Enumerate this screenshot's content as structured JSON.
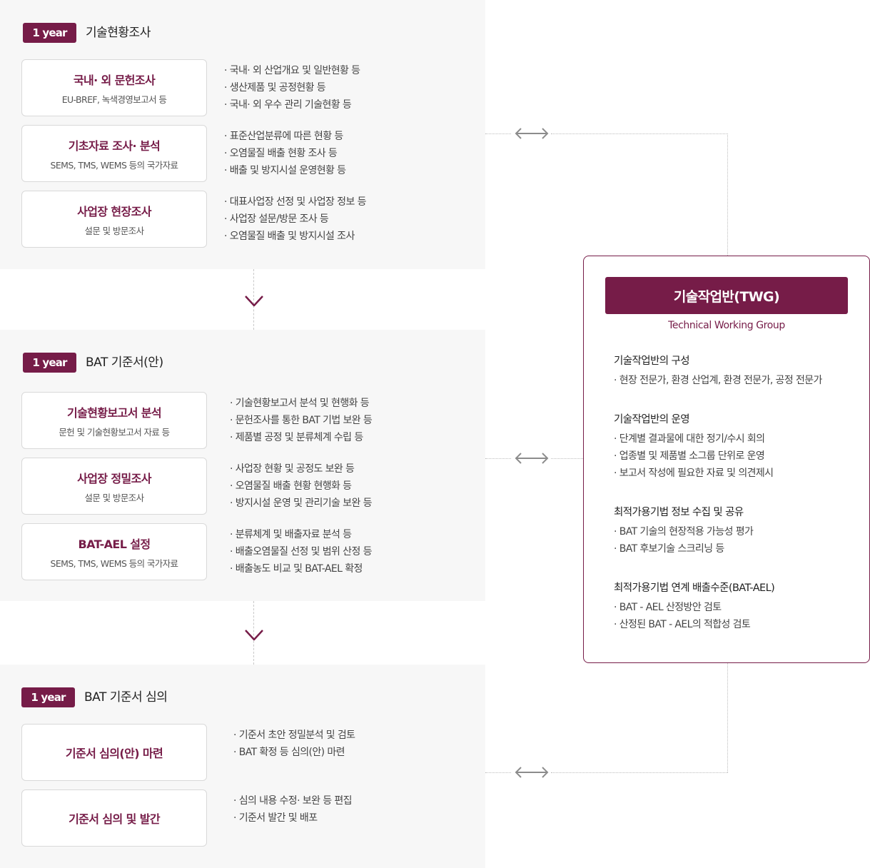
{
  "sections": [
    {
      "badge": "1 year",
      "title": "기술현황조사",
      "steps": [
        {
          "title": "국내· 외 문헌조사",
          "subtitle": "EU-BREF, 녹색경영보고서 등",
          "details": [
            "국내· 외 산업개요 및 일반현황 등",
            "생산제품 및 공정현황 등",
            "국내· 외 우수 관리 기술현황 등"
          ]
        },
        {
          "title": "기초자료 조사· 분석",
          "subtitle": "SEMS, TMS, WEMS 등의 국가자료",
          "details": [
            "표준산업분류에 따른 현황 등",
            "오염물질 배출 현황 조사 등",
            "배출 및 방지시설 운영현황 등"
          ]
        },
        {
          "title": "사업장 현장조사",
          "subtitle": "설문 및 방문조사",
          "details": [
            "대표사업장 선정 및 사업장 정보 등",
            "사업장 설문/방문 조사 등",
            "오염물질 배출 및 방지시설 조사"
          ]
        }
      ]
    },
    {
      "badge": "1 year",
      "title": "BAT 기준서(안)",
      "steps": [
        {
          "title": "기술현황보고서 분석",
          "subtitle": "문헌 및 기술현황보고서 자료 등",
          "details": [
            "기술현황보고서 분석 및 현행화 등",
            "문헌조사를 통한 BAT 기법 보완 등",
            "제품별 공정 및 분류체계 수립 등"
          ]
        },
        {
          "title": "사업장 정밀조사",
          "subtitle": "설문 및 방문조사",
          "details": [
            "사업장 현황 및 공정도 보완 등",
            "오염물질 배출 현황 현행화 등",
            "방지시설 운영 및 관리기술 보완 등"
          ]
        },
        {
          "title": "BAT-AEL 설정",
          "subtitle": "SEMS, TMS, WEMS 등의 국가자료",
          "details": [
            "분류체계 및 배출자료 분석 등",
            "배출오염물질 선정 및 범위 산정 등",
            "배출농도 비교 및  BAT-AEL 확정"
          ]
        }
      ]
    },
    {
      "badge": "1 year",
      "title": "BAT 기준서 심의",
      "steps": [
        {
          "title": "기준서 심의(안) 마련",
          "details": [
            "기준서 초안 정밀분석 및 검토",
            "BAT 확정 등 심의(안) 마련"
          ]
        },
        {
          "title": "기준서 심의 및 발간",
          "details": [
            "심의 내용 수정· 보완 등 편집",
            "기준서 발간 및 배포"
          ]
        }
      ]
    }
  ],
  "twg": {
    "title": "기술작업반(TWG)",
    "subtitle": "Technical Working Group",
    "blocks": [
      {
        "title": "기술작업반의 구성",
        "items": [
          "현장 전문가, 환경 산업계, 환경 전문가, 공정 전문가"
        ]
      },
      {
        "title": "기술작업반의 운영",
        "items": [
          "단계별 결과물에 대한 정기/수시 회의",
          "업종별 및 제품별 소그룹 단위로 운영",
          "보고서 작성에 필요한 자료 및 의견제시"
        ]
      },
      {
        "title": "최적가용기법 정보 수집 및 공유",
        "items": [
          "BAT 기술의 현장적용 가능성 평가",
          "BAT 후보기술 스크리닝 등"
        ]
      },
      {
        "title": "최적가용기법 연계 배출수준(BAT-AEL)",
        "items": [
          "BAT - AEL 산정방안 검토",
          "산정된 BAT - AEL의 적합성 검토"
        ]
      }
    ]
  },
  "colors": {
    "accent": "#761c48",
    "panel_bg": "#f7f7f7",
    "box_border": "#d9d9d9",
    "arrow": "#8c8c8c"
  },
  "icons": {
    "flow_down": "chevron-down-icon",
    "link": "double-arrow-icon"
  }
}
